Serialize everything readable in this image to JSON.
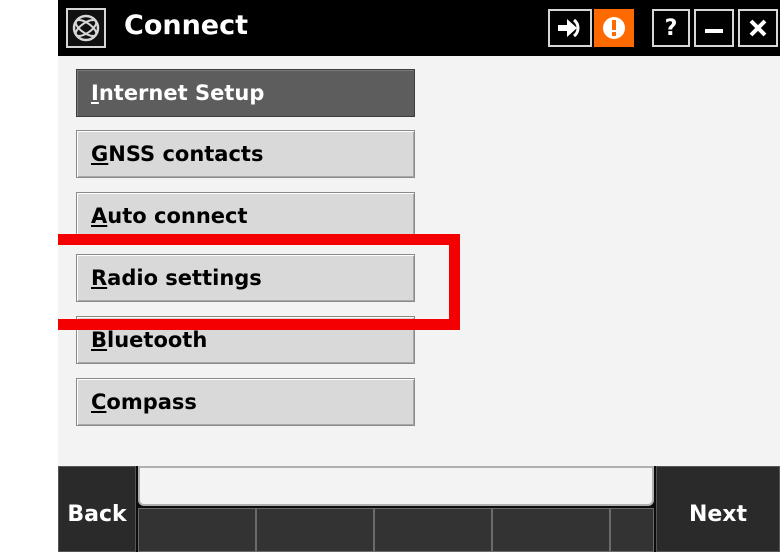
{
  "window": {
    "title": "Connect"
  },
  "titlebar": {
    "app_icon": "trimble-globe-icon",
    "buttons": [
      {
        "name": "connection-status-icon"
      },
      {
        "name": "warning-icon"
      },
      {
        "name": "help-button",
        "label": "?"
      },
      {
        "name": "minimize-button"
      },
      {
        "name": "close-button"
      }
    ],
    "colors": {
      "warning": "#ff6a00"
    }
  },
  "menu": {
    "items": [
      {
        "accel": "I",
        "rest": "nternet Setup",
        "active": true
      },
      {
        "accel": "G",
        "rest": "NSS contacts"
      },
      {
        "accel": "A",
        "rest": "uto connect"
      },
      {
        "accel": "R",
        "rest": "adio settings"
      },
      {
        "accel": "B",
        "rest": "luetooth"
      },
      {
        "accel": "C",
        "rest": "ompass"
      }
    ]
  },
  "annotation": {
    "color": "#f50000"
  },
  "softkeys": {
    "back": "Back",
    "next": "Next"
  }
}
